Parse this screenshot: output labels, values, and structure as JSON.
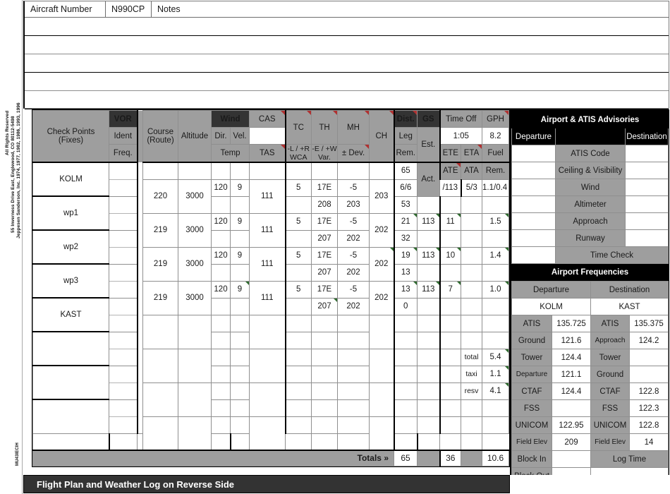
{
  "copyright": {
    "line1": "Jeppesen Sanderson, Inc. 1974, 1977, 1982, 1986, 1993, 1996",
    "line2": "55 Inverness Drive East, Englewood, CO  80112-5498",
    "line3": "All Rights Reserved",
    "form_code": "MU43IECIH"
  },
  "top": {
    "aircraft_number_label": "Aircraft Number",
    "aircraft_number_value": "N990CP",
    "notes_label": "Notes"
  },
  "navlog_header": {
    "check_points_l1": "Check Points",
    "check_points_l2": "(Fixes)",
    "vor": "VOR",
    "ident": "Ident",
    "freq": "Freq.",
    "course_l1": "Course",
    "course_l2": "(Route)",
    "altitude": "Altitude",
    "wind": "Wind",
    "dir": "Dir.",
    "vel": "Vel.",
    "temp": "Temp",
    "cas": "CAS",
    "tas": "TAS",
    "tc": "TC",
    "wca": "-L / +R",
    "wca2": "WCA",
    "th": "TH",
    "var": "-E / +W",
    "var2": "Var.",
    "mh": "MH",
    "dev": "± Dev.",
    "ch": "CH",
    "dist": "Dist.",
    "leg": "Leg",
    "rem": "Rem.",
    "dist_rem_value": "65",
    "gs": "GS",
    "est": "Est.",
    "act": "Act.",
    "time_off": "Time Off",
    "time_off_value": "1:05",
    "ete": "ETE",
    "eta": "ETA",
    "ate": "ATE",
    "ata": "ATA",
    "gph": "GPH",
    "gph_value": "8.2",
    "fuel": "Fuel",
    "fuel_rem": "Rem."
  },
  "legs": [
    {
      "checkpoint": "KOLM",
      "course": "220",
      "altitude": "3000",
      "wind_dir": "120",
      "wind_vel": "9",
      "temp": "",
      "cas": "",
      "tas": "111",
      "tc": "5",
      "wca": "",
      "th": "17E",
      "th2": "208",
      "mh": "-5",
      "mh2": "203",
      "ch": "203",
      "dist_leg": "6/6",
      "dist_rem": "53",
      "gs_est": "/113",
      "gs_act": "",
      "ete": "5/3",
      "eta": "",
      "ate": "",
      "ata": "",
      "fuel": "1.1/0.4",
      "fuel_rem": ""
    },
    {
      "checkpoint": "wp1",
      "course": "219",
      "altitude": "3000",
      "wind_dir": "120",
      "wind_vel": "9",
      "temp": "",
      "cas": "",
      "tas": "111",
      "tc": "5",
      "wca": "",
      "th": "17E",
      "th2": "207",
      "mh": "-5",
      "mh2": "202",
      "ch": "202",
      "dist_leg": "21",
      "dist_rem": "32",
      "gs_est": "113",
      "gs_act": "",
      "ete": "11",
      "eta": "",
      "ate": "",
      "ata": "",
      "fuel": "1.5",
      "fuel_rem": ""
    },
    {
      "checkpoint": "wp2",
      "course": "219",
      "altitude": "3000",
      "wind_dir": "120",
      "wind_vel": "9",
      "temp": "",
      "cas": "",
      "tas": "111",
      "tc": "5",
      "wca": "",
      "th": "17E",
      "th2": "207",
      "mh": "-5",
      "mh2": "202",
      "ch": "202",
      "dist_leg": "19",
      "dist_rem": "13",
      "gs_est": "113",
      "gs_act": "",
      "ete": "10",
      "eta": "",
      "ate": "",
      "ata": "",
      "fuel": "1.4",
      "fuel_rem": ""
    },
    {
      "checkpoint": "wp3",
      "course": "219",
      "altitude": "3000",
      "wind_dir": "120",
      "wind_vel": "9",
      "temp": "",
      "cas": "",
      "tas": "111",
      "tc": "5",
      "wca": "",
      "th": "17E",
      "th2": "207",
      "mh": "-5",
      "mh2": "202",
      "ch": "202",
      "dist_leg": "13",
      "dist_rem": "0",
      "gs_est": "113",
      "gs_act": "",
      "ete": "7",
      "eta": "",
      "ate": "",
      "ata": "",
      "fuel": "1.0",
      "fuel_rem": ""
    },
    {
      "checkpoint": "KAST",
      "course": "",
      "altitude": "",
      "wind_dir": "",
      "wind_vel": "",
      "temp": "",
      "cas": "",
      "tas": "",
      "tc": "",
      "wca": "",
      "th": "",
      "th2": "",
      "mh": "",
      "mh2": "",
      "ch": "",
      "dist_leg": "",
      "dist_rem": "",
      "gs_est": "",
      "gs_act": "",
      "ete": "",
      "eta": "",
      "ate": "",
      "ata": "",
      "fuel": "",
      "fuel_rem": ""
    },
    {
      "checkpoint": "",
      "course": "",
      "altitude": "",
      "wind_dir": "",
      "wind_vel": "",
      "temp": "",
      "cas": "",
      "tas": "",
      "tc": "",
      "wca": "",
      "th": "",
      "th2": "",
      "mh": "",
      "mh2": "",
      "ch": "",
      "dist_leg": "",
      "dist_rem": "",
      "gs_est": "",
      "gs_act": "",
      "ete": "",
      "eta": "",
      "ate": "",
      "ata": "",
      "fuel": "total",
      "fuel_rem": "5.4",
      "fuel_is_label": true
    },
    {
      "checkpoint": "",
      "course": "",
      "altitude": "",
      "wind_dir": "",
      "wind_vel": "",
      "temp": "",
      "cas": "",
      "tas": "",
      "tc": "",
      "wca": "",
      "th": "",
      "th2": "",
      "mh": "",
      "mh2": "",
      "ch": "",
      "dist_leg": "",
      "dist_rem": "",
      "gs_est": "",
      "gs_act": "",
      "ete": "",
      "eta": "",
      "ate": "",
      "ata": "",
      "fuel": "resv",
      "fuel_rem": "4.1",
      "fuel_is_label": true
    },
    {
      "checkpoint": "",
      "course": "",
      "altitude": "",
      "wind_dir": "",
      "wind_vel": "",
      "temp": "",
      "cas": "",
      "tas": "",
      "tc": "",
      "wca": "",
      "th": "",
      "th2": "",
      "mh": "",
      "mh2": "",
      "ch": "",
      "dist_leg": "",
      "dist_rem": "",
      "gs_est": "",
      "gs_act": "",
      "ete": "",
      "eta": "",
      "ate": "",
      "ata": "",
      "fuel": "",
      "fuel_rem": ""
    }
  ],
  "sub_fuel": {
    "taxi_label": "taxi",
    "taxi_value": "1.1"
  },
  "totals": {
    "label": "Totals »",
    "dist": "65",
    "gs": "",
    "time": "36",
    "blank": "",
    "fuel": "10.6"
  },
  "atis": {
    "title": "Airport & ATIS Advisories",
    "departure": "Departure",
    "destination": "Destination",
    "rows": [
      {
        "label": "ATIS Code",
        "dep": "",
        "dst": ""
      },
      {
        "label": "Ceiling & Visibility",
        "dep": "",
        "dst": ""
      },
      {
        "label": "Wind",
        "dep": "",
        "dst": ""
      },
      {
        "label": "Altimeter",
        "dep": "",
        "dst": ""
      },
      {
        "label": "Approach",
        "dep": "",
        "dst": ""
      },
      {
        "label": "Runway",
        "dep": "",
        "dst": ""
      }
    ],
    "time_check": "Time Check"
  },
  "freqs": {
    "title": "Airport Frequencies",
    "departure": "Departure",
    "destination": "Destination",
    "dep_airport": "KOLM",
    "dst_airport": "KAST",
    "rows": [
      {
        "dep_label": "ATIS",
        "dep_value": "135.725",
        "dst_label": "ATIS",
        "dst_value": "135.375"
      },
      {
        "dep_label": "Ground",
        "dep_value": "121.6",
        "dst_label": "Approach",
        "dst_value": "124.2"
      },
      {
        "dep_label": "Tower",
        "dep_value": "124.4",
        "dst_label": "Tower",
        "dst_value": ""
      },
      {
        "dep_label": "Departure",
        "dep_value": "121.1",
        "dst_label": "Ground",
        "dst_value": ""
      },
      {
        "dep_label": "CTAF",
        "dep_value": "124.4",
        "dst_label": "CTAF",
        "dst_value": "122.8"
      },
      {
        "dep_label": "FSS",
        "dep_value": "",
        "dst_label": "FSS",
        "dst_value": "122.3"
      },
      {
        "dep_label": "UNICOM",
        "dep_value": "122.95",
        "dst_label": "UNICOM",
        "dst_value": "122.8"
      },
      {
        "dep_label": "Field Elev",
        "dep_value": "209",
        "dst_label": "Field Elev",
        "dst_value": "14"
      }
    ],
    "block_in": "Block In",
    "block_out": "Block Out",
    "log_time": "Log Time"
  },
  "footer": {
    "text": "Flight Plan and Weather Log on Reverse Side"
  }
}
